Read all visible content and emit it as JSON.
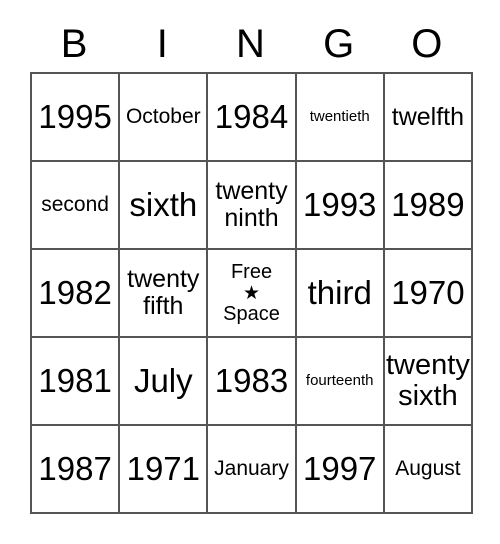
{
  "card": {
    "header": {
      "letters": [
        "B",
        "I",
        "N",
        "G",
        "O"
      ]
    },
    "rows": [
      [
        {
          "text": "1995",
          "size": "xl"
        },
        {
          "text": "October",
          "size": "sm"
        },
        {
          "text": "1984",
          "size": "xl"
        },
        {
          "text": "twentieth",
          "size": "xs"
        },
        {
          "text": "twelfth",
          "size": "md"
        }
      ],
      [
        {
          "text": "second",
          "size": "sm"
        },
        {
          "text": "sixth",
          "size": "xl"
        },
        {
          "text": "twenty ninth",
          "size": "md"
        },
        {
          "text": "1993",
          "size": "xl"
        },
        {
          "text": "1989",
          "size": "xl"
        }
      ],
      [
        {
          "text": "1982",
          "size": "xl"
        },
        {
          "text": "twenty fifth",
          "size": "md"
        },
        {
          "text": "Free Space",
          "size": "free",
          "free_top": "Free",
          "free_star": "★",
          "free_bottom": "Space"
        },
        {
          "text": "third",
          "size": "xl"
        },
        {
          "text": "1970",
          "size": "xl"
        }
      ],
      [
        {
          "text": "1981",
          "size": "xl"
        },
        {
          "text": "July",
          "size": "xl"
        },
        {
          "text": "1983",
          "size": "xl"
        },
        {
          "text": "fourteenth",
          "size": "xs"
        },
        {
          "text": "twenty sixth",
          "size": "lg"
        }
      ],
      [
        {
          "text": "1987",
          "size": "xl"
        },
        {
          "text": "1971",
          "size": "xl"
        },
        {
          "text": "January",
          "size": "sm"
        },
        {
          "text": "1997",
          "size": "xl"
        },
        {
          "text": "August",
          "size": "sm"
        }
      ]
    ],
    "colors": {
      "background": "#ffffff",
      "text": "#000000",
      "border": "#555555"
    }
  }
}
